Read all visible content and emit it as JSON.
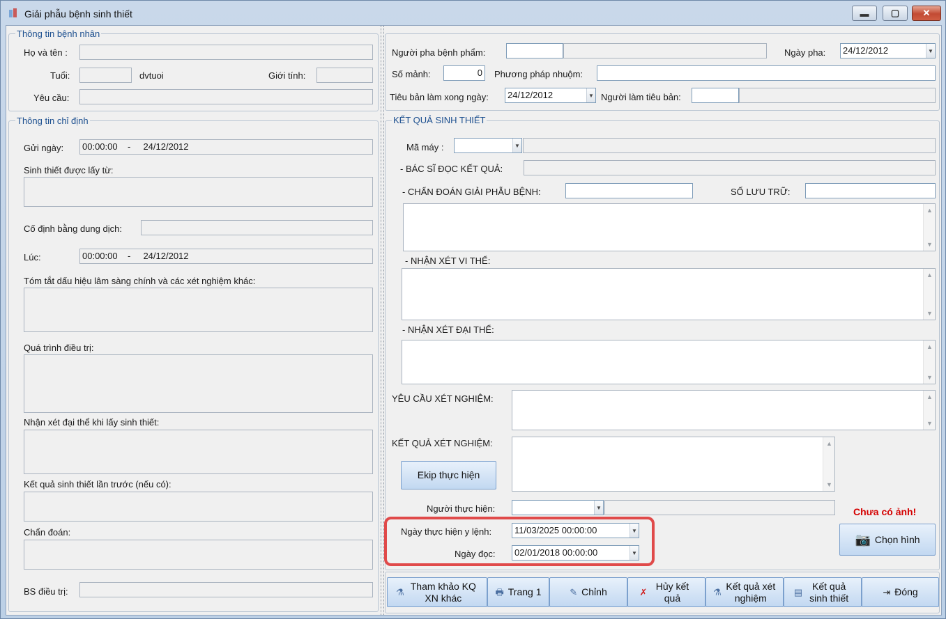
{
  "window": {
    "title": "Giải phẫu bệnh sinh thiết",
    "minimize": "▬",
    "maximize": "▢",
    "close": "✕"
  },
  "patient": {
    "legend": "Thông tin bệnh nhân",
    "name_label": "Họ và tên :",
    "age_label": "Tuổi:",
    "age_unit": "dvtuoi",
    "gender_label": "Giới tính:",
    "request_label": "Yêu cầu:"
  },
  "order": {
    "legend": "Thông tin chỉ định",
    "sent_label": "Gửi ngày:",
    "sent_value": "00:00:00    -     24/12/2012",
    "source_label": "Sinh thiết được lấy từ:",
    "fix_label": "Cố định bằng dung dịch:",
    "at_label": "Lúc:",
    "at_value": "00:00:00    -     24/12/2012",
    "summary_label": "Tóm tắt dấu hiệu lâm sàng chính và các xét nghiệm khác:",
    "treatment_label": "Quá trình điều trị:",
    "gross_label": "Nhận xét đại thể khi lấy sinh thiết:",
    "previous_label": "Kết quả sinh thiết lần trước (nếu có):",
    "diagnosis_label": "Chẩn đoán:",
    "doctor_label": "BS điều trị:"
  },
  "prep": {
    "preparer_label": "Người pha bệnh phẩm:",
    "date_label": "Ngày pha:",
    "date_value": "24/12/2012",
    "pieces_label": "Số mảnh:",
    "pieces_value": "0",
    "stain_label": "Phương pháp nhuộm:",
    "slide_date_label": "Tiêu bản làm xong ngày:",
    "slide_date_value": "24/12/2012",
    "slide_maker_label": "Người làm tiêu bản:"
  },
  "result": {
    "legend": "KẾT QUẢ SINH THIẾT",
    "machine_label": "Mã máy :",
    "reader_label": "- BÁC SĨ ĐỌC KẾT QUẢ:",
    "diagnosis_label": "- CHẨN ĐOÁN GIẢI PHẪU BỆNH:",
    "archive_label": "SỐ LƯU TRỮ:",
    "micro_label": "- NHẬN XÉT VI THỂ:",
    "macro_label": "- NHẬN XÉT ĐẠI THỂ:",
    "test_request_label": "YÊU CẦU XÉT NGHIỆM:",
    "test_result_label": "KẾT QUẢ XÉT NGHIỆM:",
    "ekip_button": "Ekip thực hiện",
    "performer_label": "Người thực hiện:",
    "order_date_label": "Ngày thực hiện y lệnh:",
    "order_date_value": "11/03/2025 00:00:00",
    "read_date_label": "Ngày đọc:",
    "read_date_value": "02/01/2018 00:00:00",
    "no_image": "Chưa có ảnh!",
    "choose_image": "Chọn hình"
  },
  "toolbar": {
    "ref_label": "Tham khảo KQ XN khác",
    "page_label": "Trang 1",
    "edit_label": "Chỉnh",
    "cancel_label": "Hủy kết quả",
    "test_result_label": "Kết quả xét nghiệm",
    "biopsy_result_label": "Kết quả sinh thiết",
    "close_label": "Đóng"
  },
  "colors": {
    "legend": "#1c4f8f",
    "highlight": "#e04a4a",
    "warning": "#d40000"
  }
}
